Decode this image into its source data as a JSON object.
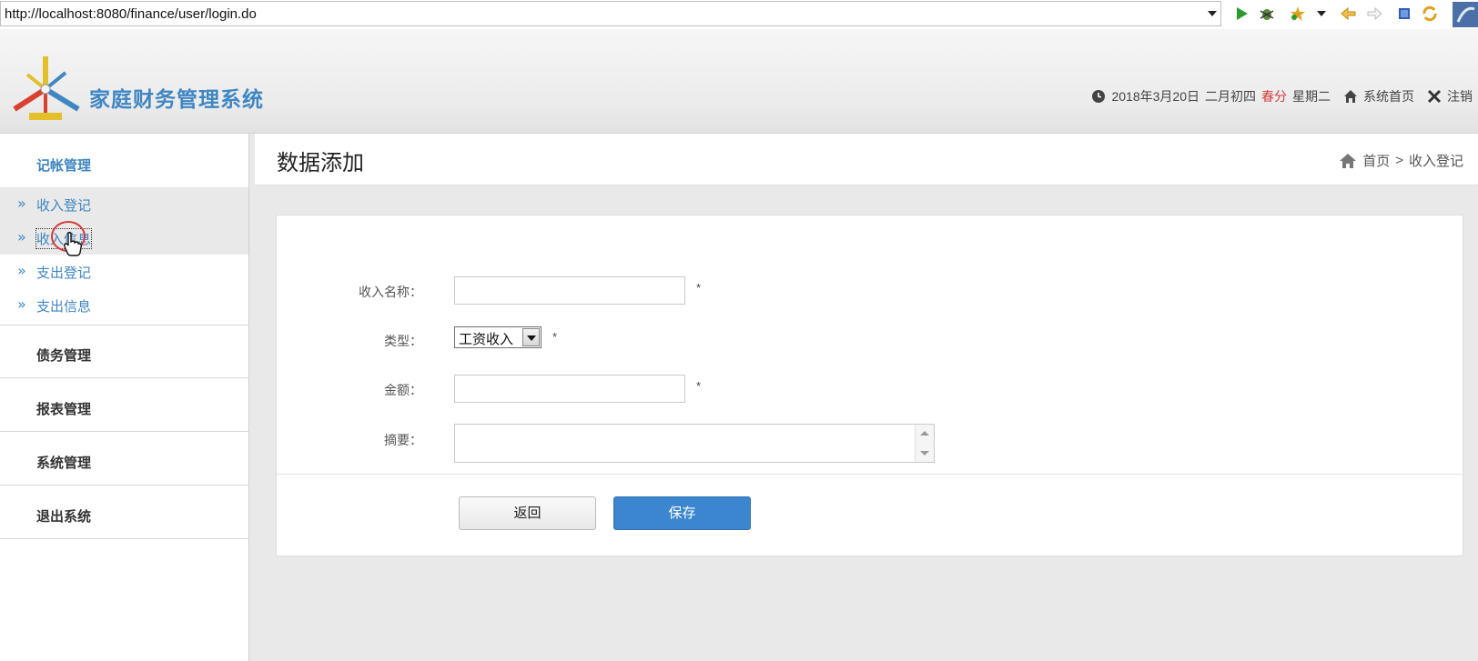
{
  "browser": {
    "url": "http://localhost:8080/finance/user/login.do"
  },
  "header": {
    "app_title": "家庭财务管理系统",
    "date": "2018年3月20日",
    "lunar_date": "二月初四",
    "solar_term": "春分",
    "weekday": "星期二",
    "home_link": "系统首页",
    "logout_link": "注销"
  },
  "sidebar": {
    "sections": [
      {
        "title": "记帐管理",
        "active": true,
        "items": [
          {
            "label": "收入登记"
          },
          {
            "label": "收入信息"
          },
          {
            "label": "支出登记"
          },
          {
            "label": "支出信息"
          }
        ]
      },
      {
        "title": "债务管理"
      },
      {
        "title": "报表管理"
      },
      {
        "title": "系统管理"
      },
      {
        "title": "退出系统"
      }
    ]
  },
  "page": {
    "title": "数据添加",
    "breadcrumb": [
      "首页",
      "收入登记"
    ],
    "breadcrumb_sep": ">"
  },
  "form": {
    "fields": [
      {
        "label": "收入名称：",
        "value": "",
        "required": "*"
      },
      {
        "label": "类型：",
        "value": "工资收入",
        "required": "*"
      },
      {
        "label": "金额：",
        "value": "",
        "required": "*"
      },
      {
        "label": "摘要：",
        "value": ""
      }
    ],
    "back_label": "返回",
    "save_label": "保存"
  },
  "colors": {
    "accent": "#3f86c3",
    "save_button": "#3b86cf",
    "solar_term": "#d63a3a"
  }
}
